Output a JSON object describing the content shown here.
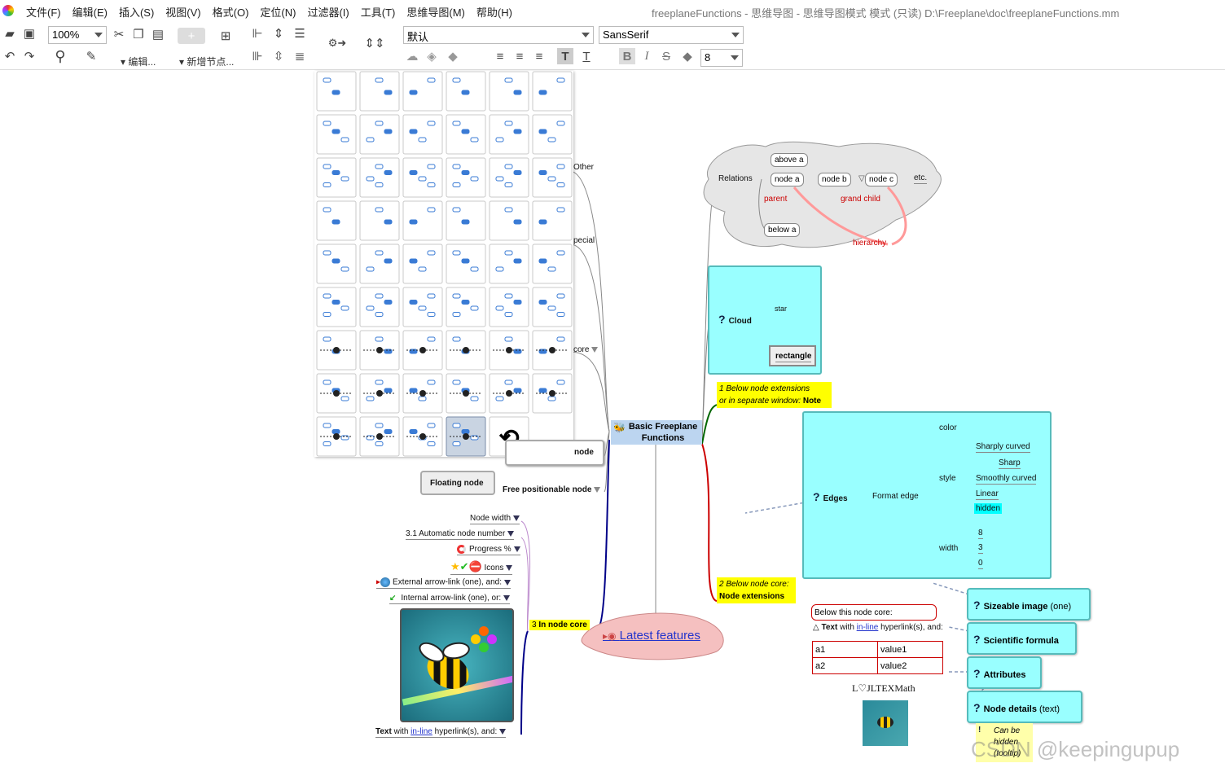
{
  "window": {
    "title": "freeplaneFunctions - 思维导图 - 思维导图模式 模式 (只读) D:\\Freeplane\\doc\\freeplaneFunctions.mm",
    "menu": [
      "文件(F)",
      "编辑(E)",
      "插入(S)",
      "视图(V)",
      "格式(O)",
      "定位(N)",
      "过滤器(I)",
      "工具(T)",
      "思维导图(M)",
      "帮助(H)"
    ]
  },
  "toolbar": {
    "zoom": "100%",
    "edit_label": "▾ 编辑...",
    "new_node_label": "▾ 新增节点...",
    "style_select": "默认",
    "font_select": "SansSerif",
    "font_size": "8"
  },
  "map": {
    "root": "Basic Freeplane Functions",
    "latest": "Latest features",
    "branches_left": {
      "other": "Other",
      "special": "pecial",
      "core": "core",
      "node": "node",
      "floating": "Floating node",
      "free": "Free positionable node"
    },
    "relations": {
      "label": "Relations",
      "above": "above a",
      "node_a": "node a",
      "node_b": "node b",
      "node_c": "node c",
      "etc": "etc.",
      "parent": "parent",
      "grand_child": "grand child",
      "below": "below a",
      "hierarchy": "hierarchy"
    },
    "cloud": {
      "label": "Cloud",
      "star": "star",
      "rectangle": "rectangle"
    },
    "note1": {
      "line1": "1 Below node extensions",
      "line2": "or in separate window: ",
      "bold": "Note"
    },
    "edges": {
      "label": "Edges",
      "format": "Format edge",
      "color": "color",
      "style": "style",
      "width": "width",
      "styles": [
        "Sharply curved",
        "Sharp",
        "Smoothly curved",
        "Linear",
        "hidden"
      ],
      "widths": [
        "8",
        "3",
        "0"
      ]
    },
    "note2": {
      "line1": "2 Below node core:",
      "line2": "Node extensions"
    },
    "below_core": {
      "header": "Below this node core:",
      "text_b": "Text",
      "text_mid": " with ",
      "link": "in-line",
      "text_end": " hyperlink(s), and:"
    },
    "attributes_table": [
      [
        "a1",
        "value1"
      ],
      [
        "a2",
        "value2"
      ]
    ],
    "latex": "L♡JLTEXMath",
    "right_buttons": [
      {
        "bold": "Sizeable image",
        "rest": " (one)"
      },
      {
        "bold": "Scientific formula",
        "rest": ""
      },
      {
        "bold": "Attributes",
        "rest": ""
      },
      {
        "bold": "Node details",
        "rest": " (text)"
      }
    ],
    "tooltip": {
      "l1": "Can be",
      "l2": "hidden",
      "l3": "(tooltip)"
    },
    "left_list": [
      "Node width",
      "3.1 Automatic node number",
      "Progress %",
      "Icons",
      "External arrow-link (one), and:",
      "Internal arrow-link (one), or:"
    ],
    "in_core": {
      "num": "3 ",
      "rest": "In node core"
    },
    "bottom_text": {
      "b": "Text",
      "mid": " with ",
      "link": "in-line",
      "end": " hyperlink(s), and:"
    }
  },
  "watermark": "CSDN @keepingupup",
  "colors": {
    "cyan": "#99ffff",
    "note_yellow": "#ffff00",
    "root_blue": "#aaccee",
    "latest_pink": "#f5c0c0",
    "edge_red": "#cc0000"
  }
}
